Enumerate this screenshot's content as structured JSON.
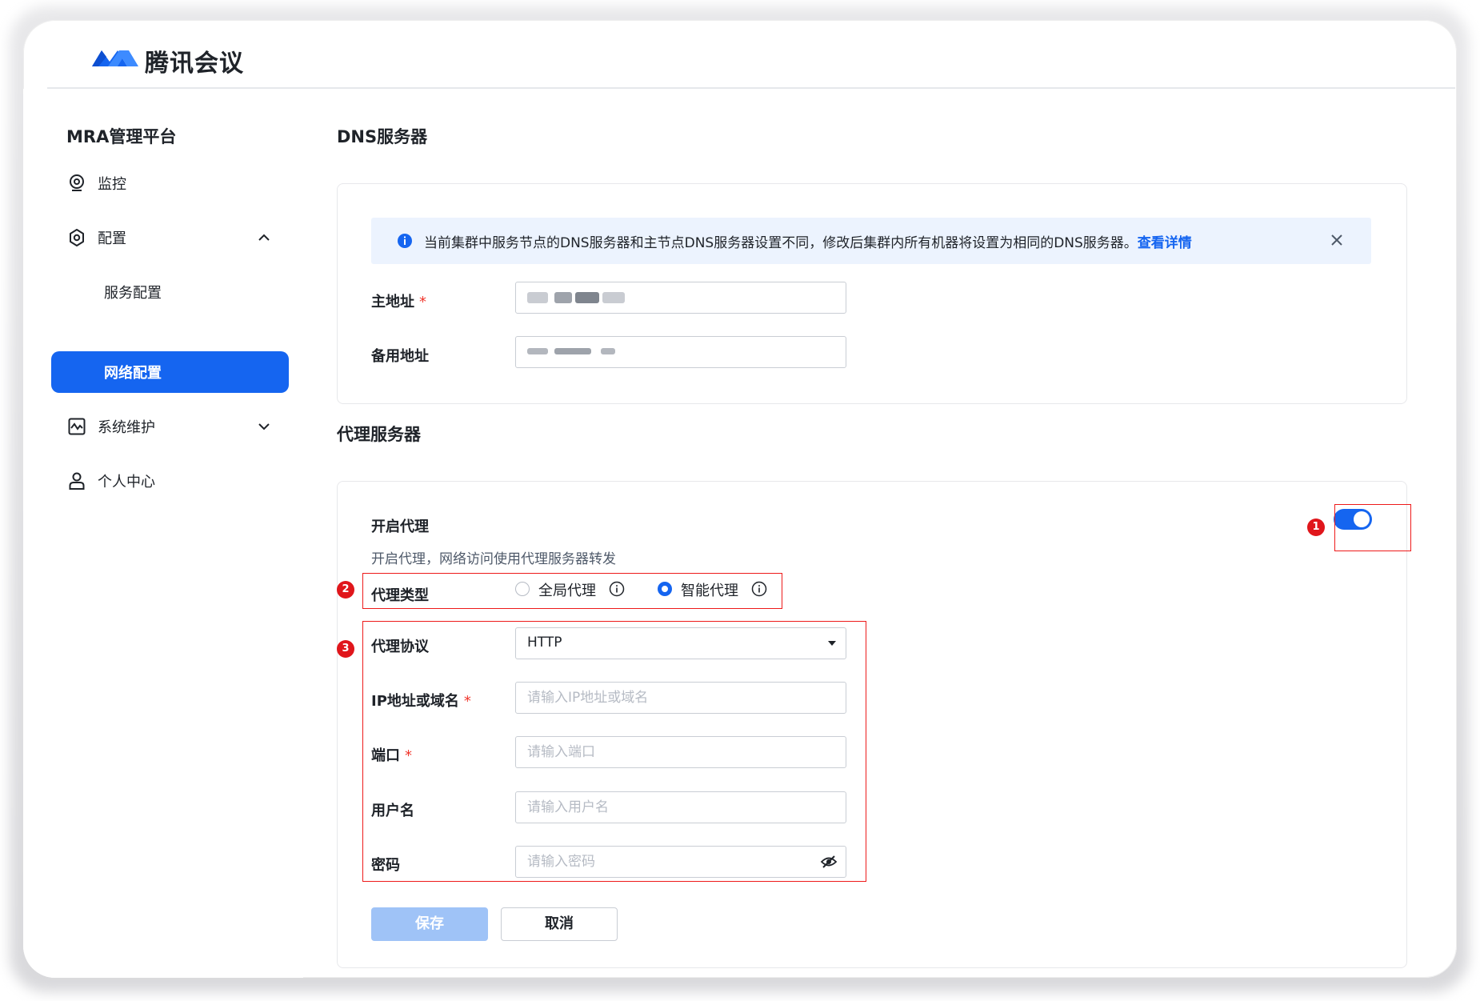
{
  "brand": {
    "name": "腾讯会议"
  },
  "sidebar": {
    "title": "MRA管理平台",
    "items": [
      {
        "label": "监控",
        "icon": "monitor-icon"
      },
      {
        "label": "配置",
        "icon": "settings-icon",
        "expanded": true
      },
      {
        "label": "服务配置"
      },
      {
        "label": "网络配置",
        "active": true
      },
      {
        "label": "系统维护",
        "icon": "maintenance-icon",
        "expanded": false
      },
      {
        "label": "个人中心",
        "icon": "user-icon"
      }
    ]
  },
  "dns": {
    "title": "DNS服务器",
    "banner": {
      "text": "当前集群中服务节点的DNS服务器和主节点DNS服务器设置不同，修改后集群内所有机器将设置为相同的DNS服务器。",
      "link": "查看详情"
    },
    "primary_label": "主地址",
    "secondary_label": "备用地址"
  },
  "proxy": {
    "title": "代理服务器",
    "enable_label": "开启代理",
    "enable_desc": "开启代理，网络访问使用代理服务器转发",
    "enabled": true,
    "type_label": "代理类型",
    "type_options": [
      {
        "label": "全局代理",
        "selected": false
      },
      {
        "label": "智能代理",
        "selected": true
      }
    ],
    "protocol_label": "代理协议",
    "protocol_value": "HTTP",
    "ip_label": "IP地址或域名",
    "ip_placeholder": "请输入IP地址或域名",
    "port_label": "端口",
    "port_placeholder": "请输入端口",
    "username_label": "用户名",
    "username_placeholder": "请输入用户名",
    "password_label": "密码",
    "password_placeholder": "请输入密码",
    "save_label": "保存",
    "cancel_label": "取消"
  },
  "annotations": [
    "1",
    "2",
    "3"
  ],
  "colors": {
    "accent": "#1565f0",
    "annotation": "#ee1a1a",
    "disabled_primary": "#9fc3f7"
  }
}
